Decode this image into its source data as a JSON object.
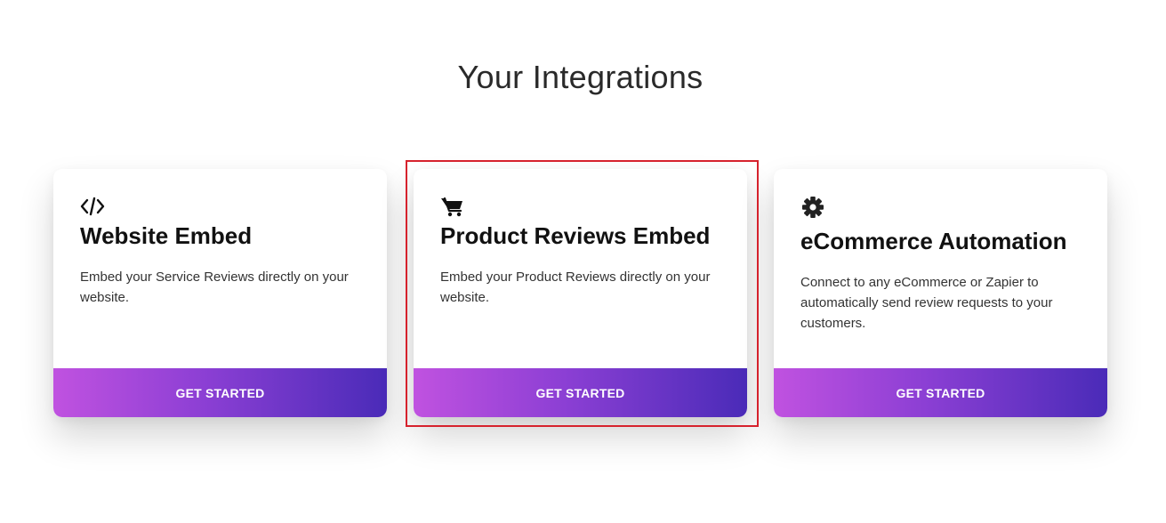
{
  "page": {
    "title": "Your Integrations"
  },
  "cards": [
    {
      "icon": "code-icon",
      "title": "Website Embed",
      "description": "Embed your Service Reviews directly on your website.",
      "cta_label": "GET STARTED"
    },
    {
      "icon": "shopping-cart-icon",
      "title": "Product Reviews Embed",
      "description": "Embed your Product Reviews directly on your website.",
      "cta_label": "GET STARTED"
    },
    {
      "icon": "gear-icon",
      "title": "eCommerce Automation",
      "description": "Connect to any eCommerce or Zapier to automatically send review requests to your customers.",
      "cta_label": "GET STARTED"
    }
  ],
  "colors": {
    "gradient_start": "#c052e0",
    "gradient_end": "#4a2bb8",
    "highlight_border": "#d6222d"
  }
}
